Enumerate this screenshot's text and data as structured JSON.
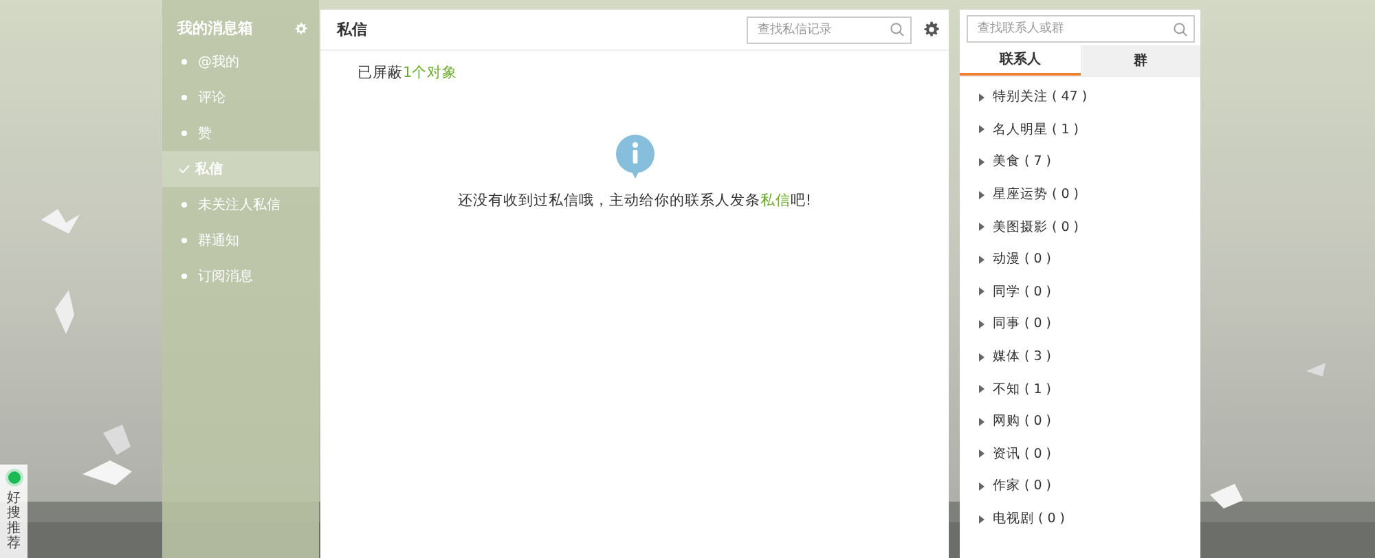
{
  "sidebar": {
    "title": "我的消息箱",
    "items": [
      {
        "label": "@我的",
        "selected": false
      },
      {
        "label": "评论",
        "selected": false
      },
      {
        "label": "赞",
        "selected": false
      },
      {
        "label": "私信",
        "selected": true
      },
      {
        "label": "未关注人私信",
        "selected": false
      },
      {
        "label": "群通知",
        "selected": false
      },
      {
        "label": "订阅消息",
        "selected": false
      }
    ]
  },
  "main": {
    "title": "私信",
    "search": {
      "placeholder": "查找私信记录"
    },
    "blocked_prefix": "已屏蔽",
    "blocked_link": "1个对象",
    "empty_before": "还没有收到过私信哦，主动给你的联系人发条",
    "empty_link": "私信",
    "empty_after": "吧!"
  },
  "contacts": {
    "search": {
      "placeholder": "查找联系人或群"
    },
    "tabs": [
      {
        "label": "联系人",
        "selected": true
      },
      {
        "label": "群",
        "selected": false
      }
    ],
    "groups": [
      {
        "label": "特别关注 ( 47 )",
        "expanded": false
      },
      {
        "label": "名人明星 ( 1 )",
        "expanded": false
      },
      {
        "label": "美食 ( 7 )",
        "expanded": false
      },
      {
        "label": "星座运势 ( 0 )",
        "expanded": false
      },
      {
        "label": "美图摄影 ( 0 )",
        "expanded": false
      },
      {
        "label": "动漫 ( 0 )",
        "expanded": false
      },
      {
        "label": "同学 ( 0 )",
        "expanded": false
      },
      {
        "label": "同事 ( 0 )",
        "expanded": false
      },
      {
        "label": "媒体 ( 3 )",
        "expanded": false
      },
      {
        "label": "不知 ( 1 )",
        "expanded": false
      },
      {
        "label": "网购 ( 0 )",
        "expanded": false
      },
      {
        "label": "资讯 ( 0 )",
        "expanded": false
      },
      {
        "label": "作家 ( 0 )",
        "expanded": false
      },
      {
        "label": "电视剧 ( 0 )",
        "expanded": false
      }
    ]
  },
  "side_widget": {
    "label": "好搜推荐"
  }
}
